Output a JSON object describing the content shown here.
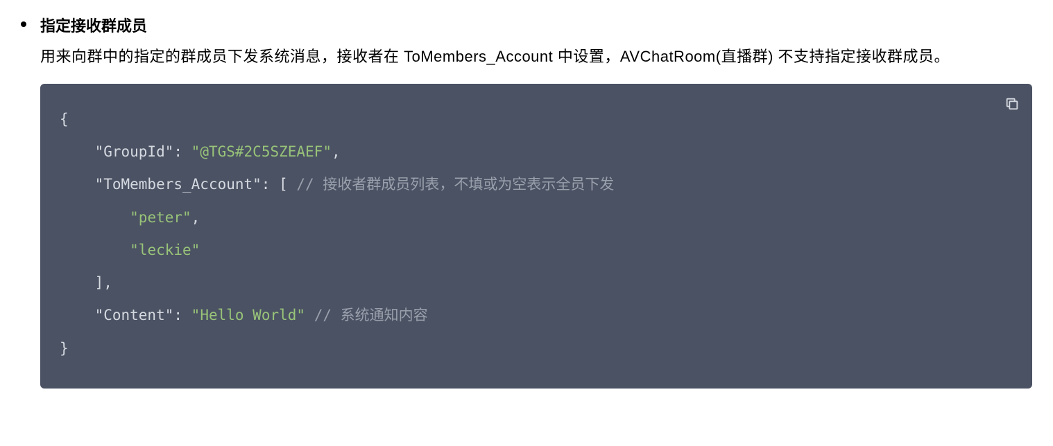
{
  "heading": "指定接收群成员",
  "description": "用来向群中的指定的群成员下发系统消息，接收者在 ToMembers_Account 中设置，AVChatRoom(直播群) 不支持指定接收群成员。",
  "code": {
    "l1_open": "{",
    "l2_indent": "    ",
    "l2_key": "\"GroupId\"",
    "l2_colon": ": ",
    "l2_val": "\"@TGS#2C5SZEAEF\"",
    "l2_comma": ",",
    "l3_indent": "    ",
    "l3_key": "\"ToMembers_Account\"",
    "l3_colon": ": ",
    "l3_bracket": "[ ",
    "l3_comment": "// 接收者群成员列表，不填或为空表示全员下发",
    "l4_indent": "        ",
    "l4_val": "\"peter\"",
    "l4_comma": ",",
    "l5_indent": "        ",
    "l5_val": "\"leckie\"",
    "l6_indent": "    ",
    "l6_close": "],",
    "l7_indent": "    ",
    "l7_key": "\"Content\"",
    "l7_colon": ": ",
    "l7_val": "\"Hello World\"",
    "l7_space": " ",
    "l7_comment": "// 系统通知内容",
    "l8_close": "}"
  }
}
